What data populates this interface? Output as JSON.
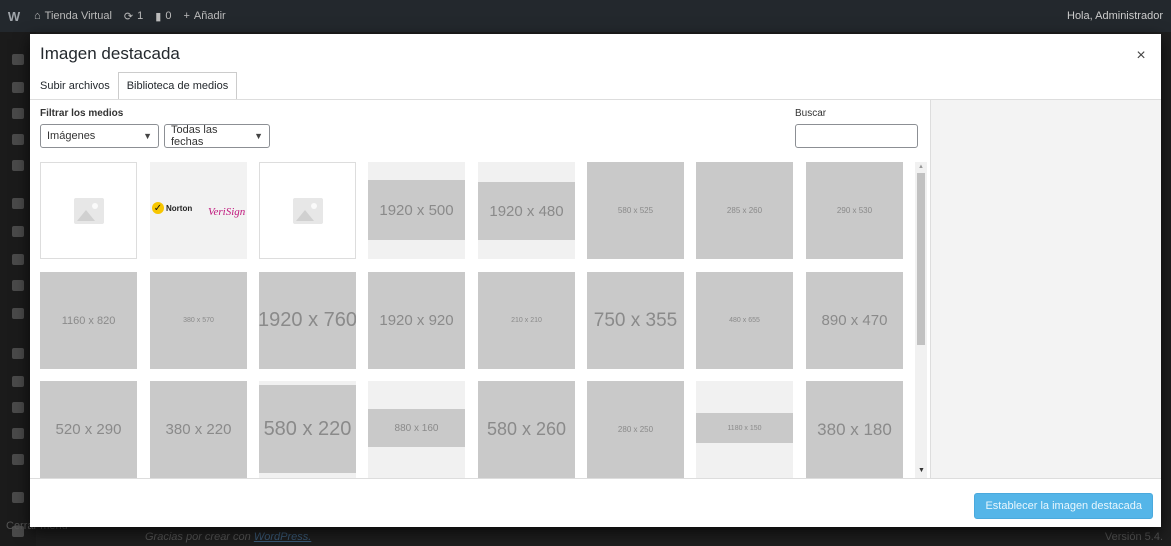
{
  "adminbar": {
    "wp_logo": "W",
    "site_name": "Tienda Virtual",
    "updates_count": "1",
    "comments_count": "0",
    "new_label": "Añadir",
    "greeting": "Hola, Administrador"
  },
  "background": {
    "footer_text": "Gracias por crear con",
    "footer_link": "WordPress.",
    "version": "Versión 5.4.",
    "collapse_menu": "Cerrar menú"
  },
  "modal": {
    "title": "Imagen destacada",
    "close_symbol": "×",
    "tabs": [
      {
        "label": "Subir archivos",
        "active": false
      },
      {
        "label": "Biblioteca de medios",
        "active": true
      }
    ],
    "filter_label": "Filtrar los medios",
    "type_filter": "Imágenes",
    "date_filter": "Todas las fechas",
    "search_label": "Buscar",
    "search_value": "",
    "primary_button": "Establecer la imagen destacada"
  },
  "media_rows": [
    [
      {
        "kind": "placeholder",
        "label": ""
      },
      {
        "kind": "logos",
        "label": "",
        "norton": "Norton",
        "verisign": "VeriSign"
      },
      {
        "kind": "placeholder",
        "label": ""
      },
      {
        "kind": "band",
        "label": "1920 x 500"
      },
      {
        "kind": "band",
        "label": "1920 x 480"
      },
      {
        "kind": "solid",
        "label": "580 x 525"
      },
      {
        "kind": "solid",
        "label": "285 x 260"
      },
      {
        "kind": "solid",
        "label": "290 x 530"
      }
    ],
    [
      {
        "kind": "solid",
        "label": "1160 x 820"
      },
      {
        "kind": "solid",
        "label": "380 x 570"
      },
      {
        "kind": "solid",
        "label": "1920 x 760"
      },
      {
        "kind": "solid",
        "label": "1920 x 920"
      },
      {
        "kind": "solid",
        "label": "210 x 210"
      },
      {
        "kind": "solid",
        "label": "750 x 355"
      },
      {
        "kind": "solid",
        "label": "480 x 655"
      },
      {
        "kind": "solid",
        "label": "890 x 470"
      }
    ],
    [
      {
        "kind": "solid",
        "label": "520 x 290"
      },
      {
        "kind": "solid",
        "label": "380 x 220"
      },
      {
        "kind": "band",
        "label": "580 x 220"
      },
      {
        "kind": "band",
        "label": "880 x 160"
      },
      {
        "kind": "solid",
        "label": "580 x 260"
      },
      {
        "kind": "solid",
        "label": "280 x 250"
      },
      {
        "kind": "band",
        "label": "1180 x 150"
      },
      {
        "kind": "solid",
        "label": "380 x 180"
      }
    ]
  ],
  "colors": {
    "primary": "#54b5e8",
    "admin_bar": "#23282d",
    "tile_gray": "#c9c9c9"
  }
}
